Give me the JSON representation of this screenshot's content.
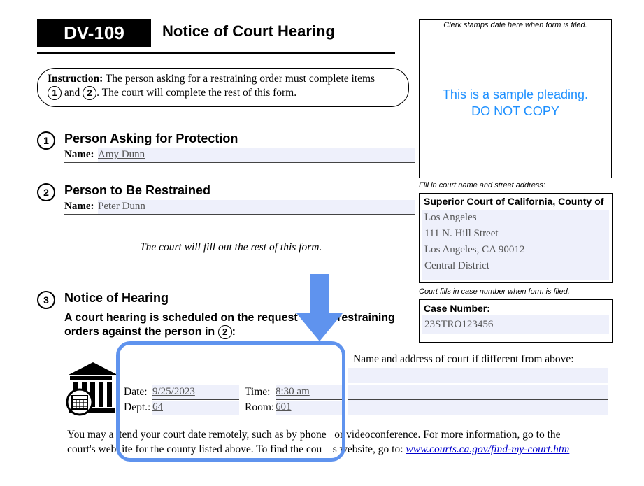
{
  "form": {
    "number": "DV-109",
    "title": "Notice of Court Hearing"
  },
  "instruction": {
    "label": "Instruction:",
    "text_a": "The person asking for a restraining order must complete items",
    "item1": "1",
    "and": "and",
    "item2": "2",
    "text_b": ". The court will complete the rest of this form."
  },
  "section1": {
    "number": "1",
    "title": "Person Asking for Protection",
    "name_label": "Name:",
    "name_value": "Amy Dunn"
  },
  "section2": {
    "number": "2",
    "title": "Person to Be Restrained",
    "name_label": "Name:",
    "name_value": "Peter Dunn"
  },
  "court_fill_note": "The court will fill out the rest of this form.",
  "section3": {
    "number": "3",
    "title": "Notice of Hearing",
    "subtitle_a": "A court hearing is scheduled on the request",
    "subtitle_b": "restraining",
    "subtitle_c": "orders against the person in",
    "subtitle_ref": "2",
    "subtitle_end": ":"
  },
  "clerk": {
    "label": "Clerk stamps date here when form is filed.",
    "sample_line1": "This is a sample pleading.",
    "sample_line2": "DO NOT COPY"
  },
  "court": {
    "label": "Fill in court name and street address:",
    "header": "Superior Court of California, County of",
    "lines": [
      "Los Angeles",
      "111 N. Hill Street",
      "Los Angeles, CA 90012",
      "Central District"
    ]
  },
  "case": {
    "label": "Court fills in case number when form is filed.",
    "header": "Case Number:",
    "value": "23STRO123456"
  },
  "hearing": {
    "alt_court_label": "Name and address of court if different from above:",
    "date_label": "Date:",
    "date_value": "9/25/2023",
    "time_label": "Time:",
    "time_value": "8:30 am",
    "dept_label": "Dept.:",
    "dept_value": "64",
    "room_label": "Room:",
    "room_value": "601",
    "remote_line1": "You may a  tend your court date remotely, such as by phone   or videoconference. For more information, go to the",
    "remote_line2_a": "court's web  ite for the county listed above. To find the cou    s website, go to: ",
    "remote_link": "www.courts.ca.gov/find-my-court.htm"
  },
  "colors": {
    "highlight": "#5f93ee",
    "sample_text": "#1e90ff",
    "field_bg": "#eef0fb"
  },
  "icons": [
    "courthouse-icon",
    "calendar-icon",
    "down-arrow-icon"
  ]
}
